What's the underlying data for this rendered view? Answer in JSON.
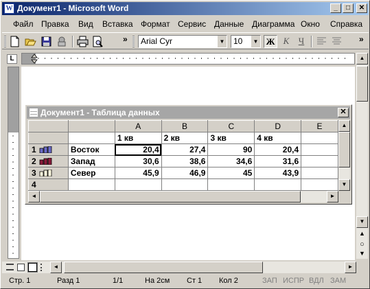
{
  "window": {
    "title": "Документ1 - Microsoft Word",
    "icon": "word-doc-icon"
  },
  "menu": [
    "Файл",
    "Правка",
    "Вид",
    "Вставка",
    "Формат",
    "Сервис",
    "Данные",
    "Диаграмма",
    "Окно",
    "Справка"
  ],
  "toolbar": {
    "font_name": "Arial Cyr",
    "font_size": "10",
    "bold": "Ж",
    "italic": "К",
    "underline": "Ч",
    "more": "»"
  },
  "ruler": {
    "corner": "L"
  },
  "datasheet": {
    "title": "Документ1 - Таблица данных",
    "columns": [
      "A",
      "B",
      "C",
      "D",
      "E"
    ],
    "series_headers": [
      "1 кв",
      "2 кв",
      "3 кв",
      "4 кв"
    ],
    "rows": [
      {
        "num": "1",
        "label": "Восток",
        "values": [
          "20,4",
          "27,4",
          "90",
          "20,4"
        ]
      },
      {
        "num": "2",
        "label": "Запад",
        "values": [
          "30,6",
          "38,6",
          "34,6",
          "31,6"
        ]
      },
      {
        "num": "3",
        "label": "Север",
        "values": [
          "45,9",
          "46,9",
          "45",
          "43,9"
        ]
      },
      {
        "num": "4",
        "label": "",
        "values": [
          "",
          "",
          "",
          ""
        ]
      }
    ],
    "row_icon_colors": [
      "#6b6bc8",
      "#8a1c3b",
      "#fffbe0"
    ]
  },
  "status": {
    "page": "Стр. 1",
    "section": "Разд 1",
    "pages": "1/1",
    "at": "На 2см",
    "line": "Ст 1",
    "col": "Кол 2",
    "rec": "ЗАП",
    "trk": "ИСПР",
    "ext": "ВДЛ",
    "ovr": "ЗАМ"
  }
}
